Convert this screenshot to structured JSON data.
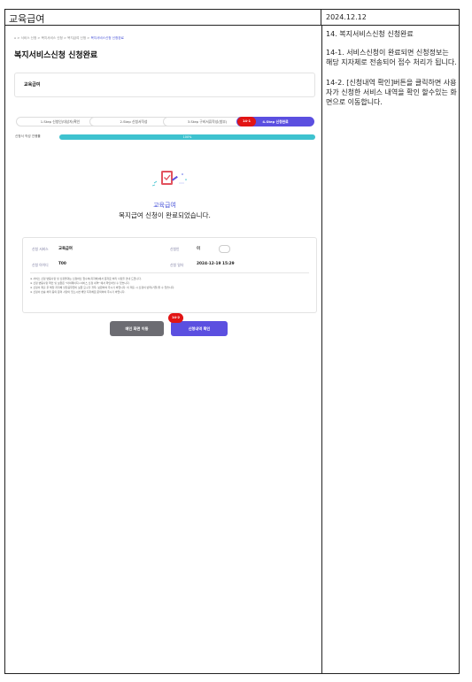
{
  "header": {
    "title": "교육급여",
    "date": "2024.12.12"
  },
  "description": {
    "heading": "14. 복지서비스신청 신청완료",
    "items": [
      "14-1. 서비스신청이 완료되면 신청정보는 해당 지자체로 전송되어 접수 처리가 됩니다.",
      "14-2. [신청내역 확인]버튼을 클릭하면 사용자가 신청한 서비스 내역을 확인 할수있는 화면으로 이동합니다."
    ]
  },
  "screen": {
    "breadcrumb": {
      "home": "⌂",
      "items": [
        "서비스 신청",
        "복지서비스 신청",
        "복지급여 신청"
      ],
      "current": "복지서비스신청 신청완료"
    },
    "page_title": "복지서비스신청 신청완료",
    "service_card": "교육급여",
    "steps": [
      "1.Step 신청인(대상자)확인",
      "2.Step 신청서작성",
      "3.Step 구비서류작성(첨부)"
    ],
    "active_step": "4.Step 신청완료",
    "badges": {
      "step": "14-1",
      "button": "14-2"
    },
    "progress": {
      "label": "신청서 작성 진행률",
      "percent_text": "100%",
      "value": 1.0
    },
    "complete_subtitle": "교육급여",
    "complete_message": "복지급여 신청이 완료되었습니다.",
    "info": {
      "service_label": "신청 서비스",
      "service_value": "교육급여",
      "applicant_label": "신청인",
      "applicant_value": "이",
      "number_label": "신청 아이디",
      "number_value": "T00",
      "date_label": "신청 일자",
      "date_value": "2024-12-19 15:29"
    },
    "notes": [
      "※ 서비스 신청 변동사항 및 신청결과는 신청하신 접수처(지자체)에서 문자로 처리 사항을 안내 드립니다.",
      "※ 신청 변동사항 확인 및 보완은 \"마이페이지>서비스 신청 내역\" 에서 확인하실 수 있습니다.",
      "※ 신청서 제출 후 해당 지자체 담당공무원이 보완 요구할 경우, 보완하여 주시기 바랍니다. 미 제출 시 신청이 반려(거절)될 수 있습니다.",
      "※ 신청서 반송 처리 등의 문의 사항이 있으시면 해당 지자체로 문의하여 주시기 바랍니다."
    ],
    "buttons": {
      "back": "메인 화면 이동",
      "confirm": "신청내역 확인"
    }
  }
}
